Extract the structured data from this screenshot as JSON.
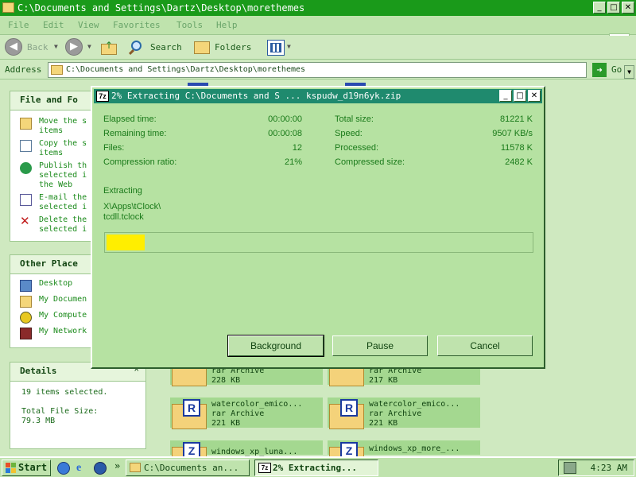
{
  "window": {
    "title": "C:\\Documents and Settings\\Dartz\\Desktop\\morethemes",
    "minimize": "_",
    "maximize": "□",
    "close": "✕"
  },
  "menu": [
    "File",
    "Edit",
    "View",
    "Favorites",
    "Tools",
    "Help"
  ],
  "toolbar": {
    "back": "Back",
    "search": "Search",
    "folders": "Folders"
  },
  "address": {
    "label": "Address",
    "value": "C:\\Documents and Settings\\Dartz\\Desktop\\morethemes",
    "go": "Go"
  },
  "left_pane": {
    "file_tasks": {
      "header": "File and Fo",
      "items": [
        {
          "line1": "Move the s",
          "line2": "items",
          "icon": "move-icon"
        },
        {
          "line1": "Copy the s",
          "line2": "items",
          "icon": "copy-icon"
        },
        {
          "line1": "Publish th",
          "line2": "selected i",
          "line3": "the Web",
          "icon": "publish-icon"
        },
        {
          "line1": "E-mail the",
          "line2": "selected i",
          "icon": "email-icon"
        },
        {
          "line1": "Delete the",
          "line2": "selected i",
          "icon": "delete-icon"
        }
      ]
    },
    "other_places": {
      "header": "Other Place",
      "items": [
        {
          "label": "Desktop",
          "icon": "desktop-icon"
        },
        {
          "label": "My Documen",
          "icon": "my-documents-icon"
        },
        {
          "label": "My Compute",
          "icon": "my-computer-icon"
        },
        {
          "label": "My Network",
          "icon": "my-network-icon"
        }
      ]
    },
    "details": {
      "header": "Details",
      "collapse": "⌃",
      "count": "19 items selected.",
      "size_label": "Total File Size:",
      "size_value": "79.3 MB"
    }
  },
  "files": [
    {
      "name": "",
      "type": "rar Archive",
      "size": "228 KB",
      "letter": "R"
    },
    {
      "name": "",
      "type": "rar Archive",
      "size": "217 KB",
      "letter": "R"
    },
    {
      "name": "watercolor_emico...",
      "type": "rar Archive",
      "size": "221 KB",
      "letter": "R"
    },
    {
      "name": "watercolor_emico...",
      "type": "rar Archive",
      "size": "221 KB",
      "letter": "R"
    },
    {
      "name": "windows_xp_luna...",
      "type": "",
      "size": "",
      "letter": "Z"
    },
    {
      "name": "windows_xp_more_...",
      "type": "",
      "size": "",
      "letter": "Z"
    }
  ],
  "dialog": {
    "title": "2% Extracting C:\\Documents and S ... kspudw_d19n6yk.zip",
    "icon_label": "7z",
    "stats_left": [
      {
        "label": "Elapsed time:",
        "value": "00:00:00"
      },
      {
        "label": "Remaining time:",
        "value": "00:00:08"
      },
      {
        "label": "Files:",
        "value": "12"
      },
      {
        "label": "Compression ratio:",
        "value": "21%"
      }
    ],
    "stats_right": [
      {
        "label": "Total size:",
        "value": "81221 K"
      },
      {
        "label": "Speed:",
        "value": "9507 KB/s"
      },
      {
        "label": "Processed:",
        "value": "11578 K"
      },
      {
        "label": "Compressed size:",
        "value": "2482 K"
      }
    ],
    "status": "Extracting",
    "path_line1": "X\\Apps\\tClock\\",
    "path_line2": "tcdll.tclock",
    "progress_fraction": 0.09,
    "buttons": {
      "background": "Background",
      "pause": "Pause",
      "cancel": "Cancel"
    }
  },
  "taskbar": {
    "start": "Start",
    "chevron": "»",
    "tasks": [
      {
        "label": "C:\\Documents an...",
        "active": false
      },
      {
        "label": "2% Extracting...",
        "active": true
      }
    ],
    "clock": "4:23 AM"
  },
  "colors": {
    "accent": "#1a9a1a",
    "dialog_title": "#1f8a6e",
    "progress": "#ffee00",
    "background": "#cfe9c0"
  }
}
